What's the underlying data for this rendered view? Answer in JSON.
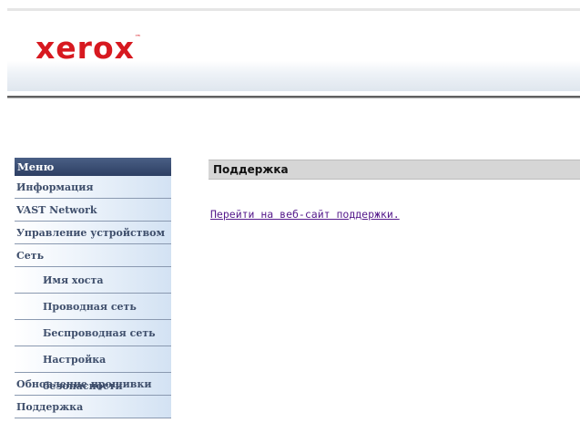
{
  "header": {
    "logo_text": "xerox",
    "logo_mark": "™",
    "brand_color": "#d71920"
  },
  "sidebar": {
    "title": "Меню",
    "items": [
      {
        "label": "Информация",
        "level": 1
      },
      {
        "label": "VAST Network",
        "level": 1
      },
      {
        "label": "Управление устройством",
        "level": 1
      },
      {
        "label": "Сеть",
        "level": 1
      },
      {
        "label": "Имя хоста",
        "level": 2
      },
      {
        "label": "Проводная сеть",
        "level": 2
      },
      {
        "label": "Беспроводная сеть",
        "level": 2
      },
      {
        "label": "Настройка безопасности",
        "level": 2
      },
      {
        "label": "Обновление прошивки",
        "level": 1
      },
      {
        "label": "Поддержка",
        "level": 1
      }
    ]
  },
  "content": {
    "title": "Поддержка",
    "link_text": "Перейти на веб-сайт поддержки."
  }
}
